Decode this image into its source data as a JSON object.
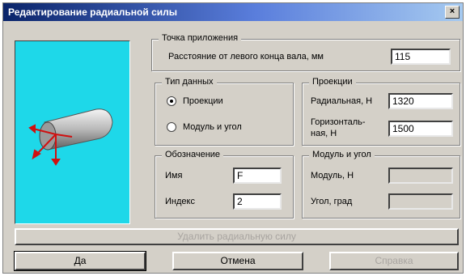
{
  "dialog": {
    "title": "Редактирование радиальной силы",
    "close_glyph": "×"
  },
  "position_group": {
    "legend": "Точка приложения",
    "distance_label": "Расстояние от левого конца вала, мм",
    "distance_value": "115"
  },
  "data_type_group": {
    "legend": "Тип данных",
    "options": [
      "Проекции",
      "Модуль и угол"
    ],
    "selected": "Проекции"
  },
  "projections_group": {
    "legend": "Проекции",
    "radial_label": "Радиальная, Н",
    "radial_value": "1320",
    "horizontal_label_line1": "Горизонталь-",
    "horizontal_label_line2": "ная, Н",
    "horizontal_value": "1500"
  },
  "designation_group": {
    "legend": "Обозначение",
    "name_label": "Имя",
    "name_value": "F",
    "index_label": "Индекс",
    "index_value": "2"
  },
  "modulus_group": {
    "legend": "Модуль и угол",
    "modulus_label": "Модуль, Н",
    "modulus_value": "",
    "angle_label": "Угол, град",
    "angle_value": ""
  },
  "buttons": {
    "delete": "Удалить радиальную силу",
    "ok": "Да",
    "cancel": "Отмена",
    "help": "Справка"
  },
  "colors": {
    "preview_bg": "#1ed8e9",
    "arrow": "#d01010"
  }
}
